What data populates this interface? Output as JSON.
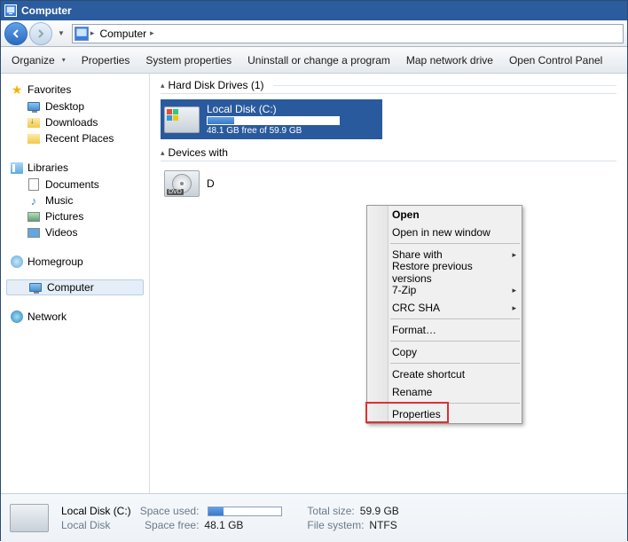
{
  "window": {
    "title": "Computer"
  },
  "breadcrumb": {
    "segment": "Computer"
  },
  "toolbar": {
    "organize": "Organize",
    "properties": "Properties",
    "system_properties": "System properties",
    "uninstall": "Uninstall or change a program",
    "map_drive": "Map network drive",
    "control_panel": "Open Control Panel"
  },
  "sidebar": {
    "favorites": {
      "label": "Favorites",
      "items": [
        "Desktop",
        "Downloads",
        "Recent Places"
      ]
    },
    "libraries": {
      "label": "Libraries",
      "items": [
        "Documents",
        "Music",
        "Pictures",
        "Videos"
      ]
    },
    "homegroup": {
      "label": "Homegroup"
    },
    "computer": {
      "label": "Computer"
    },
    "network": {
      "label": "Network"
    }
  },
  "groups": {
    "hdd": {
      "label": "Hard Disk Drives (1)"
    },
    "removable": {
      "label": "Devices with"
    }
  },
  "drives": {
    "c": {
      "name": "Local Disk (C:)",
      "free_text": "48.1 GB free of 59.9 GB"
    },
    "d": {
      "name": "D"
    }
  },
  "context_menu": {
    "open": "Open",
    "open_new": "Open in new window",
    "share": "Share with",
    "restore": "Restore previous versions",
    "sevenzip": "7-Zip",
    "crc": "CRC SHA",
    "format": "Format…",
    "copy": "Copy",
    "shortcut": "Create shortcut",
    "rename": "Rename",
    "properties": "Properties"
  },
  "details": {
    "title": "Local Disk (C:)",
    "subtitle": "Local Disk",
    "space_used_label": "Space used:",
    "space_free_label": "Space free:",
    "space_free_value": "48.1 GB",
    "total_size_label": "Total size:",
    "total_size_value": "59.9 GB",
    "fs_label": "File system:",
    "fs_value": "NTFS"
  }
}
